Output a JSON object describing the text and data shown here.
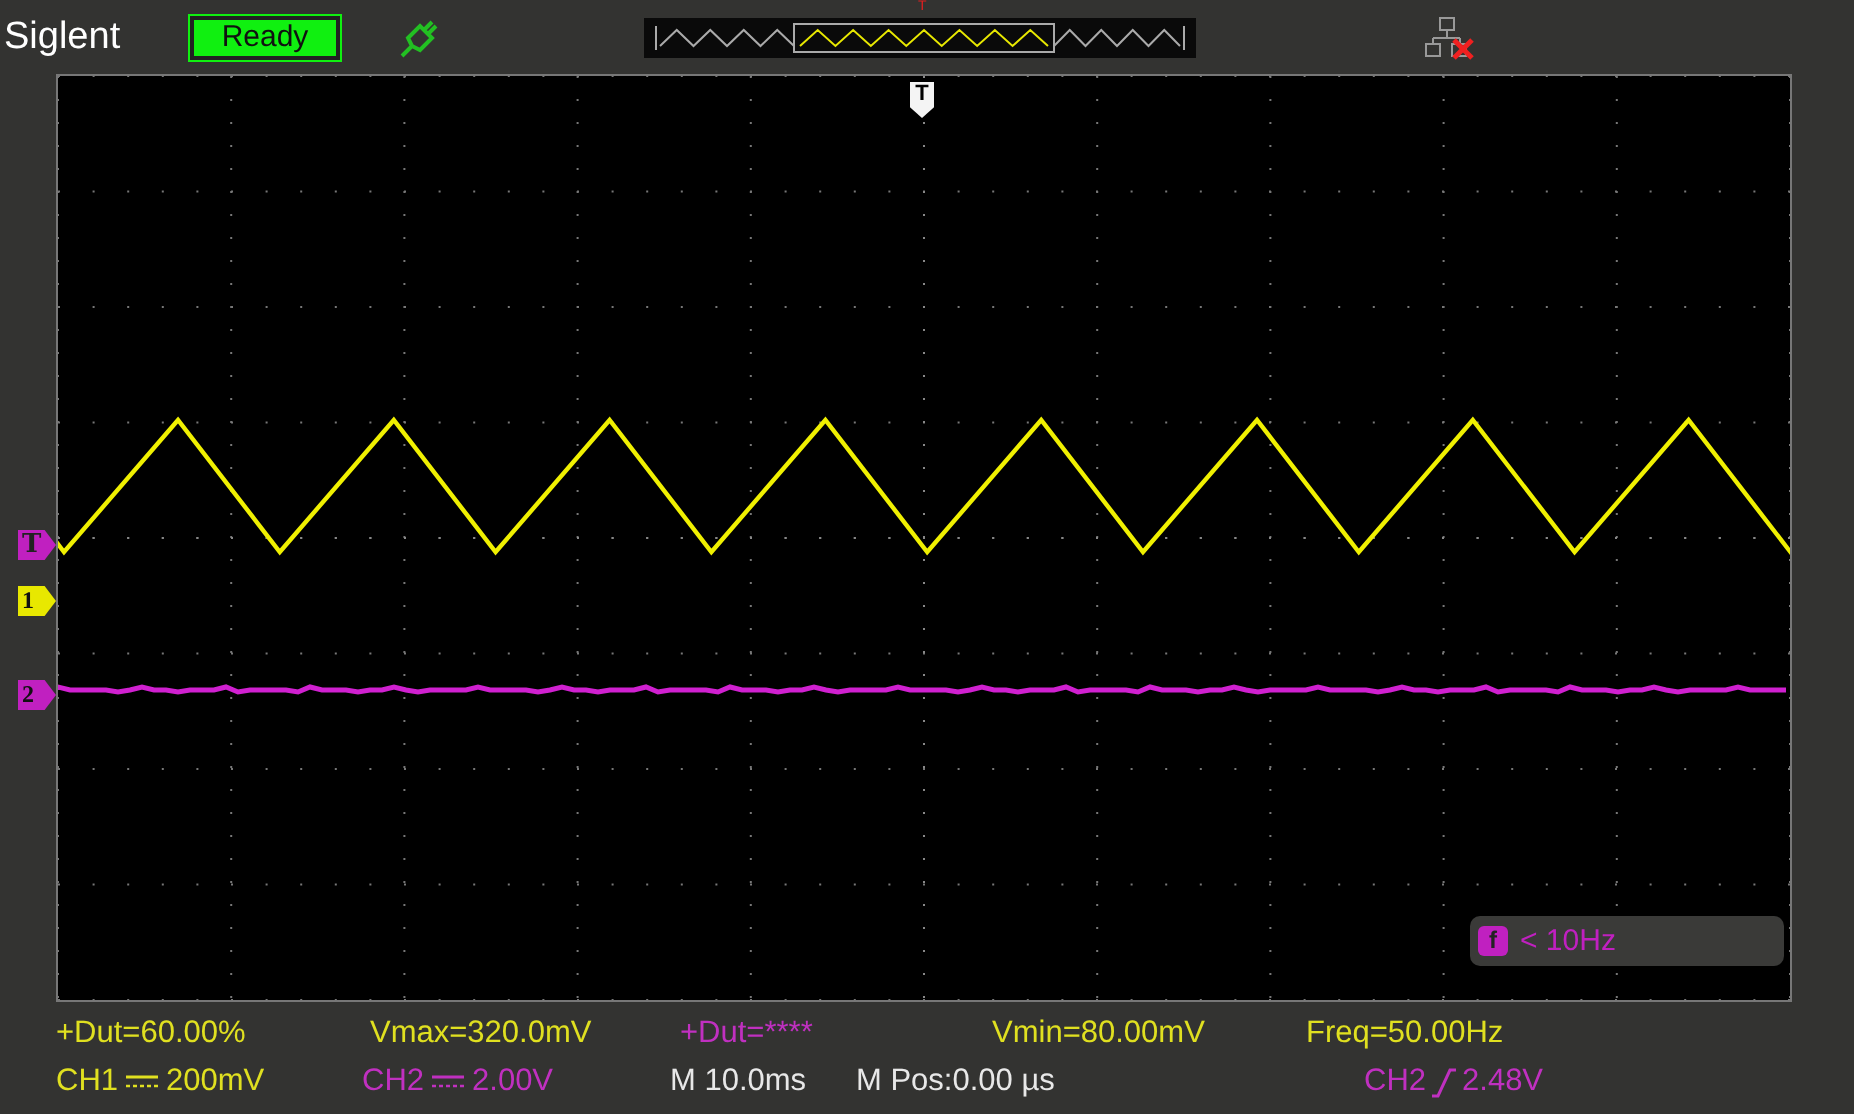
{
  "brand": "Siglent",
  "status": "Ready",
  "overview": {
    "trigger_label": "T"
  },
  "trigger_position_marker": "T",
  "markers": [
    {
      "kind": "trigger_level",
      "label": "T",
      "color": "#c020c0"
    },
    {
      "kind": "channel",
      "label": "1",
      "color": "#e8e800"
    },
    {
      "kind": "channel",
      "label": "2",
      "color": "#c020c0"
    }
  ],
  "frequency_counter": {
    "icon_label": "f",
    "reading": "< 10Hz"
  },
  "measurements": [
    {
      "text": "+Dut=60.00%",
      "color": "#e0e020"
    },
    {
      "text": "Vmax=320.0mV",
      "color": "#e0e020"
    },
    {
      "text": "+Dut=****",
      "color": "#c030c0"
    },
    {
      "text": "Vmin=80.00mV",
      "color": "#e0e020"
    },
    {
      "text": "Freq=50.00Hz",
      "color": "#e0e020"
    }
  ],
  "settings": [
    {
      "kind": "channel",
      "channel": "CH1",
      "value": "200mV",
      "color": "#e0e020"
    },
    {
      "kind": "channel",
      "channel": "CH2",
      "value": "2.00V",
      "color": "#c030c0"
    },
    {
      "kind": "text",
      "text": "M 10.0ms",
      "color": "#e8e8e8"
    },
    {
      "kind": "text",
      "text": "M Pos:0.00 µs",
      "color": "#e8e8e8"
    },
    {
      "kind": "trigger",
      "source": "CH2",
      "value": "2.48V",
      "color": "#c030c0"
    }
  ]
}
